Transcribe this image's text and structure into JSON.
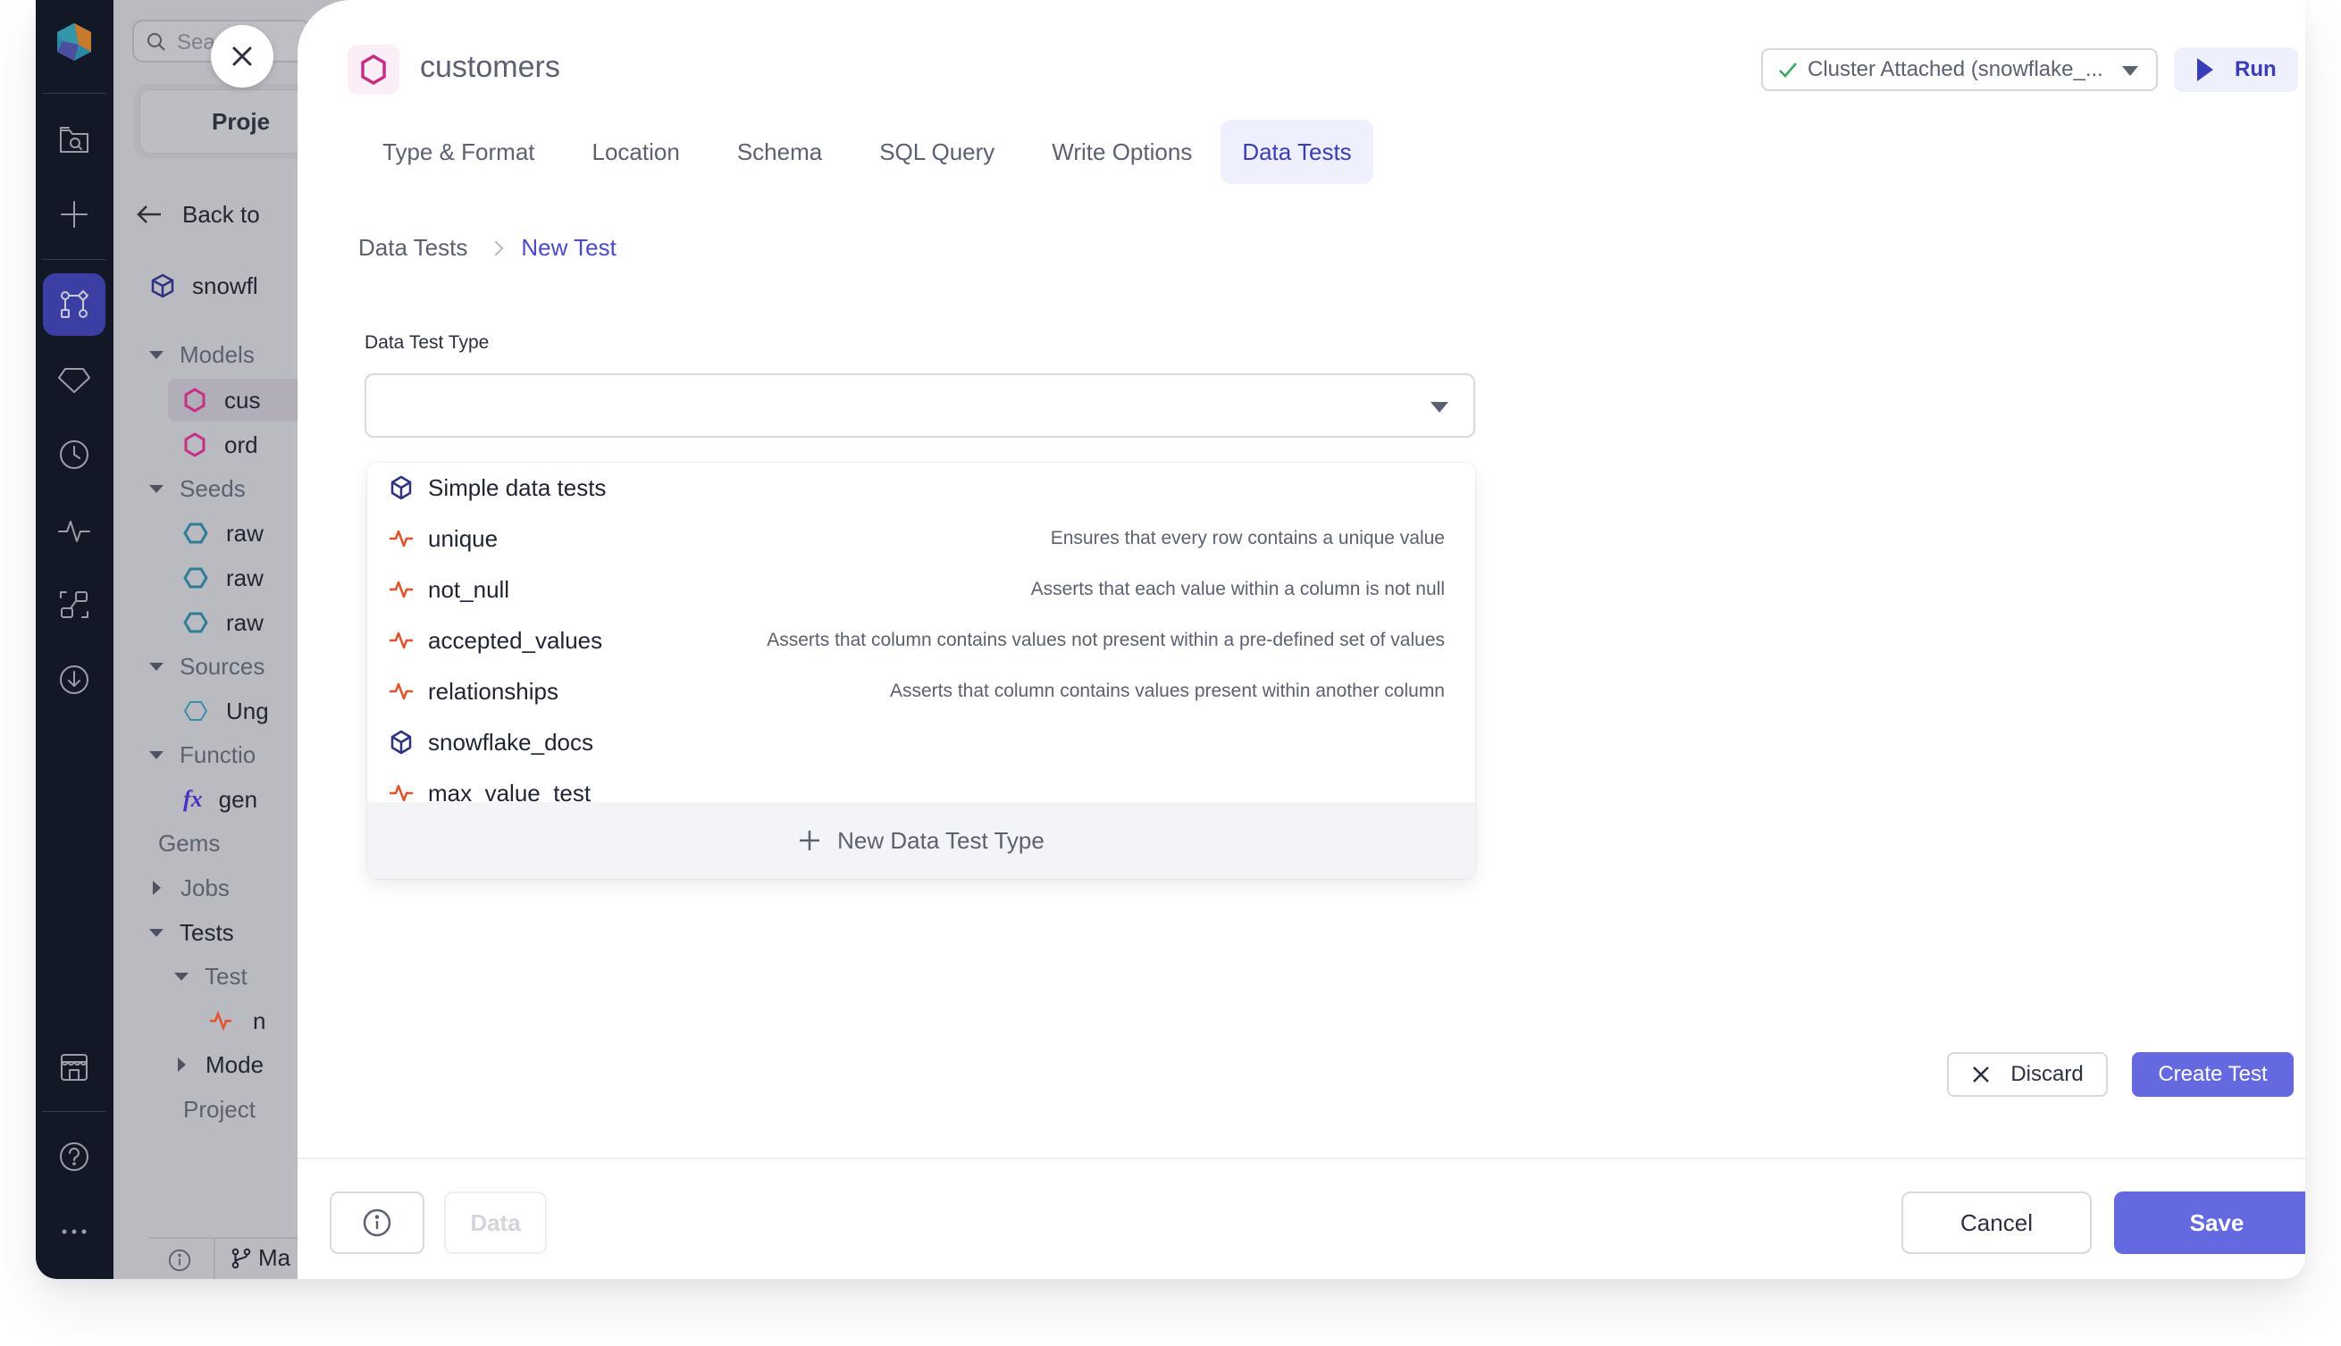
{
  "colors": {
    "accent": "#6469e0",
    "accent_text": "#3a3dba",
    "rail_bg": "#131826",
    "model_icon": "#c52f86",
    "seed_icon": "#2e7d96",
    "test_icon": "#e0532b"
  },
  "rail": {
    "items": [
      {
        "icon": "folder-search-icon"
      },
      {
        "icon": "plus-icon"
      },
      {
        "icon": "graph-icon",
        "active": true
      },
      {
        "icon": "gem-icon"
      },
      {
        "icon": "clock-icon"
      },
      {
        "icon": "pulse-icon"
      },
      {
        "icon": "lineage-icon"
      },
      {
        "icon": "download-icon"
      },
      {
        "icon": "marketplace-icon"
      },
      {
        "icon": "help-icon"
      },
      {
        "icon": "more-icon"
      }
    ]
  },
  "sidebar": {
    "search_placeholder": "Search",
    "project_button": "Proje",
    "back_label": "Back to",
    "project_name": "snowfl",
    "tree": [
      {
        "label": "Models",
        "type": "group",
        "expanded": true
      },
      {
        "label": "cus",
        "type": "model",
        "selected": true
      },
      {
        "label": "ord",
        "type": "model"
      },
      {
        "label": "Seeds",
        "type": "group",
        "expanded": true
      },
      {
        "label": "raw",
        "type": "seed"
      },
      {
        "label": "raw",
        "type": "seed"
      },
      {
        "label": "raw",
        "type": "seed"
      },
      {
        "label": "Sources",
        "type": "group",
        "expanded": true
      },
      {
        "label": "Ung",
        "type": "source"
      },
      {
        "label": "Functio",
        "type": "group",
        "expanded": true
      },
      {
        "label": "gen",
        "type": "function"
      },
      {
        "label": "Gems",
        "type": "section"
      },
      {
        "label": "Jobs",
        "type": "group",
        "expanded": false
      },
      {
        "label": "Tests",
        "type": "group",
        "expanded": true
      },
      {
        "label": "Test",
        "type": "subgroup",
        "expanded": true
      },
      {
        "label": "n",
        "type": "test"
      },
      {
        "label": "Mode",
        "type": "subgroup",
        "expanded": false
      },
      {
        "label": "Project",
        "type": "section"
      }
    ],
    "branch_label": "Ma"
  },
  "header": {
    "title": "customers",
    "cluster_status": "Cluster Attached (snowflake_...",
    "run_label": "Run"
  },
  "tabs": [
    {
      "label": "Type & Format",
      "active": false
    },
    {
      "label": "Location",
      "active": false
    },
    {
      "label": "Schema",
      "active": false
    },
    {
      "label": "SQL Query",
      "active": false
    },
    {
      "label": "Write Options",
      "active": false
    },
    {
      "label": "Data Tests",
      "active": true
    }
  ],
  "breadcrumb": [
    {
      "label": "Data Tests"
    },
    {
      "label": "New Test",
      "current": true
    }
  ],
  "form": {
    "field_label": "Data Test Type",
    "field_value": ""
  },
  "dropdown": {
    "items": [
      {
        "name": "Simple data tests",
        "icon": "cube",
        "description": ""
      },
      {
        "name": "unique",
        "icon": "pulse",
        "description": "Ensures that every row contains a unique value"
      },
      {
        "name": "not_null",
        "icon": "pulse",
        "description": "Asserts that each value within a column is not null"
      },
      {
        "name": "accepted_values",
        "icon": "pulse",
        "description": "Asserts that column contains values not present within a pre-defined set of values"
      },
      {
        "name": "relationships",
        "icon": "pulse",
        "description": "Asserts that column contains values present within another column"
      },
      {
        "name": "snowflake_docs",
        "icon": "cube",
        "description": ""
      },
      {
        "name": "max_value_test",
        "icon": "pulse",
        "description": ""
      }
    ],
    "footer_label": "New Data Test Type"
  },
  "actions": {
    "discard_label": "Discard",
    "create_label": "Create Test"
  },
  "footer": {
    "data_label": "Data",
    "cancel_label": "Cancel",
    "save_label": "Save"
  }
}
